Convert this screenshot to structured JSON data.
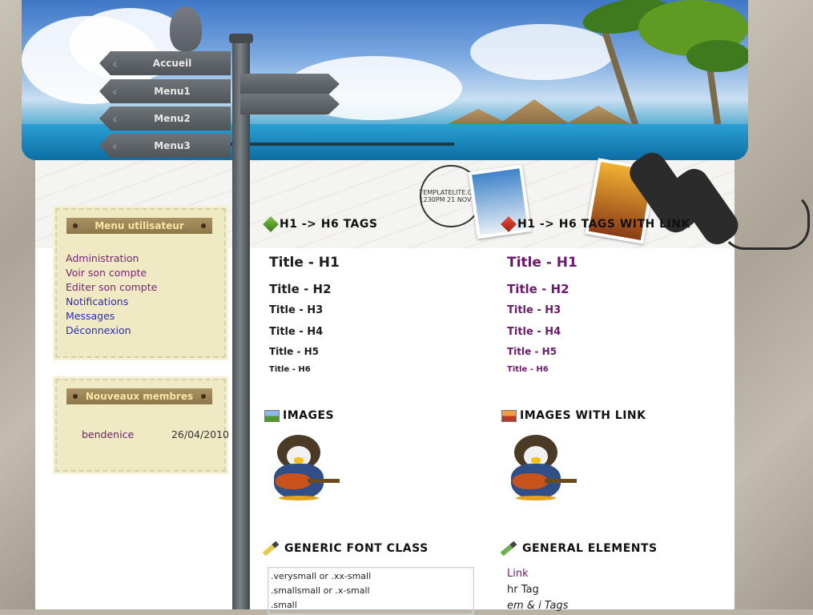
{
  "nav": {
    "items": [
      "Accueil",
      "Menu1",
      "Menu2",
      "Menu3"
    ]
  },
  "decor": {
    "postmark_text": "TEMPLATELITE.COM 1230PM 21 NOV"
  },
  "sidebar": {
    "user_menu": {
      "title": "Menu utilisateur",
      "items": [
        {
          "label": "Administration",
          "state": "visited"
        },
        {
          "label": "Voir son compte",
          "state": "visited"
        },
        {
          "label": "Editer son compte",
          "state": "visited"
        },
        {
          "label": "Notifications",
          "state": "link"
        },
        {
          "label": "Messages",
          "state": "link"
        },
        {
          "label": "Déconnexion",
          "state": "link"
        }
      ]
    },
    "new_members": {
      "title": "Nouveaux membres",
      "members": [
        {
          "name": "bendenice",
          "date": "26/04/2010"
        }
      ]
    }
  },
  "content": {
    "h_tags": {
      "title": "H1 -> H6 TAGS",
      "items": [
        "Title - H1",
        "Title - H2",
        "Title - H3",
        "Title - H4",
        "Title - H5",
        "Title - H6"
      ]
    },
    "h_tags_link": {
      "title": "H1 -> H6 TAGS WITH LINK",
      "items": [
        "Title - H1",
        "Title - H2",
        "Title - H3",
        "Title - H4",
        "Title - H5",
        "Title - H6"
      ]
    },
    "images": {
      "title": "IMAGES"
    },
    "images_link": {
      "title": "IMAGES WITH LINK"
    },
    "generic_font": {
      "title": "GENERIC FONT CLASS",
      "lines": [
        ".verysmall or .xx-small",
        ".smallsmall or .x-small",
        ".small"
      ]
    },
    "general_elements": {
      "title": "GENERAL ELEMENTS",
      "link": "Link",
      "hr": "hr Tag",
      "em": "em & i Tags"
    }
  },
  "colors": {
    "visited_link": "#7a1f7a",
    "link": "#2b2bb8",
    "box_bg": "#efeac4",
    "box_title_bg": "#a99263"
  }
}
